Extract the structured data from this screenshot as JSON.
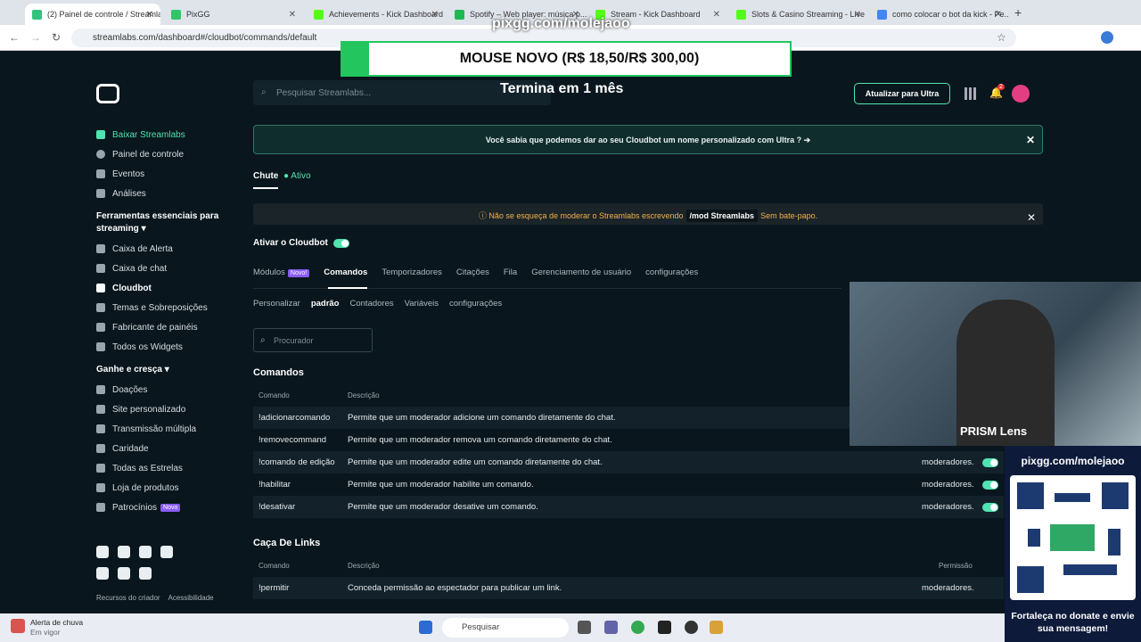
{
  "browser": {
    "tabs": [
      {
        "label": "(2) Painel de controle / Streamlabs",
        "color": "#31c27c"
      },
      {
        "label": "PixGG",
        "color": "#35c36a"
      },
      {
        "label": "Achievements - Kick Dashboard",
        "color": "#53fc18"
      },
      {
        "label": "Spotify – Web player: música p...",
        "color": "#1db954"
      },
      {
        "label": "Stream - Kick Dashboard",
        "color": "#53fc18"
      },
      {
        "label": "Slots & Casino Streaming - Live",
        "color": "#53fc18"
      },
      {
        "label": "como colocar o bot da kick - Pe...",
        "color": "#4285f4"
      }
    ],
    "url": "streamlabs.com/dashboard#/cloudbot/commands/default"
  },
  "overlay": {
    "top_text": "pixgg.com/molejaoo",
    "promo": "MOUSE NOVO (R$ 18,50/R$ 300,00)",
    "ends": "Termina em 1 mês"
  },
  "sidebar": {
    "top": [
      {
        "label": "Baixar Streamlabs",
        "icon": "download-icon"
      },
      {
        "label": "Painel de controle",
        "icon": "dashboard-icon"
      },
      {
        "label": "Eventos",
        "icon": "events-icon"
      },
      {
        "label": "Análises",
        "icon": "analytics-icon"
      }
    ],
    "group1_title": "Ferramentas essenciais para streaming",
    "group1": [
      {
        "label": "Caixa de Alerta"
      },
      {
        "label": "Caixa de chat"
      },
      {
        "label": "Cloudbot"
      },
      {
        "label": "Temas e Sobreposições"
      },
      {
        "label": "Fabricante de painéis"
      },
      {
        "label": "Todos os Widgets"
      }
    ],
    "group2_title": "Ganhe e cresça",
    "group2": [
      {
        "label": "Doações"
      },
      {
        "label": "Site personalizado"
      },
      {
        "label": "Transmissão múltipla"
      },
      {
        "label": "Caridade"
      },
      {
        "label": "Todas as Estrelas"
      },
      {
        "label": "Loja de produtos"
      },
      {
        "label": "Patrocínios",
        "badge": "Novo"
      }
    ],
    "footer_links": [
      "Recursos do criador",
      "Acessibilidade"
    ]
  },
  "header": {
    "search_placeholder": "Pesquisar Streamlabs...",
    "upgrade": "Atualizar para Ultra",
    "notif_count": "2"
  },
  "info_banner": "Você sabia que podemos dar ao seu Cloudbot um nome personalizado com Ultra ? ➔",
  "platform": {
    "name": "Chute",
    "status": "Ativo"
  },
  "warn": {
    "pre": "Não se esqueça de moderar o Streamlabs escrevendo",
    "cmd": "/mod Streamlabs",
    "post": "Sem bate-papo."
  },
  "cloudbot_toggle_label": "Ativar o Cloudbot",
  "tabs_main": [
    "Módulos",
    "Comandos",
    "Temporizadores",
    "Citações",
    "Fila",
    "Gerenciamento de usuário",
    "configurações"
  ],
  "tabs_main_badge": "Novo!",
  "tabs_sub": [
    "Personalizar",
    "padrão",
    "Contadores",
    "Variáveis",
    "configurações"
  ],
  "search_commands_placeholder": "Procurador",
  "commands_section": {
    "title": "Comandos",
    "col_command": "Comando",
    "col_desc": "Descrição",
    "rows": [
      {
        "cmd": "!adicionarcomando",
        "desc": "Permite que um moderador adicione um comando diretamente do chat.",
        "perm": ""
      },
      {
        "cmd": "!removecommand",
        "desc": "Permite que um moderador remova um comando diretamente do chat.",
        "perm": ""
      },
      {
        "cmd": "!comando de edição",
        "desc": "Permite que um moderador edite um comando diretamente do chat.",
        "perm": "moderadores."
      },
      {
        "cmd": "!habilitar",
        "desc": "Permite que um moderador habilite um comando.",
        "perm": "moderadores."
      },
      {
        "cmd": "!desativar",
        "desc": "Permite que um moderador desative um comando.",
        "perm": "moderadores."
      }
    ]
  },
  "links_section": {
    "title": "Caça De Links",
    "col_command": "Comando",
    "col_desc": "Descrição",
    "col_perm": "Permissão",
    "rows": [
      {
        "cmd": "!permitir",
        "desc": "Conceda permissão ao espectador para publicar um link.",
        "perm": "moderadores."
      }
    ]
  },
  "camera": {
    "label": "PRISM Lens"
  },
  "qr": {
    "top": "pixgg.com/molejaoo",
    "bottom": "Fortaleça no donate e envie sua mensagem!"
  },
  "taskbar": {
    "weather_title": "Alerta de chuva",
    "weather_sub": "Em vigor",
    "search": "Pesquisar"
  }
}
